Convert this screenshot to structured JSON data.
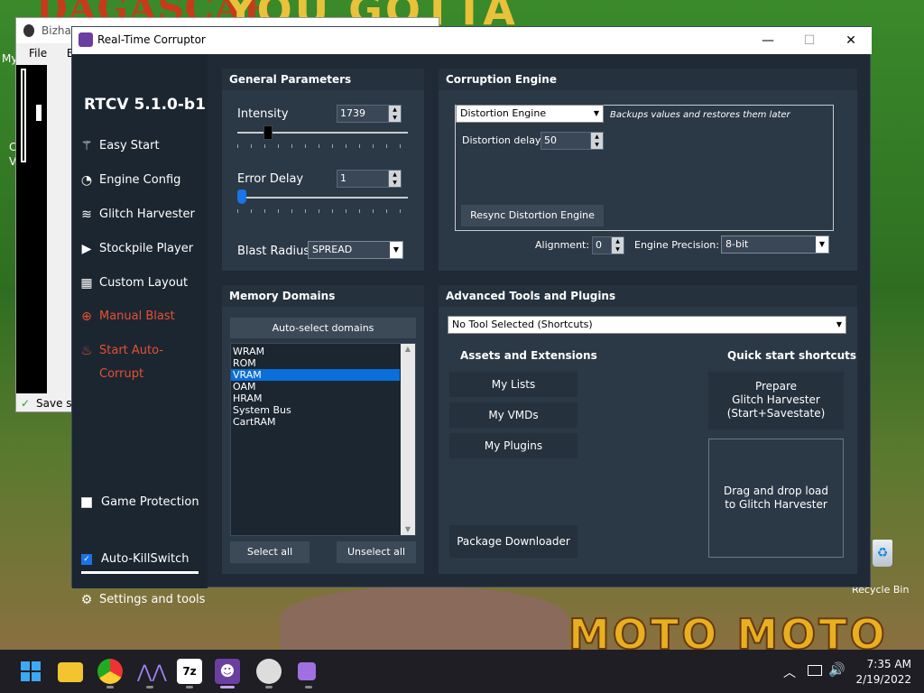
{
  "desktop": {
    "background_title": "DAGASCAR",
    "background_title2": "YOU GOTTA",
    "background_bottom": "MOTO MOTO",
    "left_labels": [
      "My",
      "C",
      "V"
    ],
    "recycle_bin_label": "Recycle Bin"
  },
  "bizhawk": {
    "title": "Bizhaw",
    "menu": [
      "File",
      "Em"
    ],
    "status": "Save slo"
  },
  "rtc": {
    "title": "Real-Time Corruptor",
    "window_buttons": {
      "minimize": "—",
      "maximize": "☐",
      "close": "✕"
    },
    "sidebar": {
      "version": "RTCV 5.1.0-b1",
      "items": [
        {
          "label": "Easy Start",
          "icon": "wand-icon",
          "color": "#ffffff"
        },
        {
          "label": "Engine Config",
          "icon": "gauge-icon",
          "color": "#ffffff"
        },
        {
          "label": "Glitch Harvester",
          "icon": "layers-icon",
          "color": "#ffffff"
        },
        {
          "label": "Stockpile Player",
          "icon": "play-icon",
          "color": "#ffffff"
        },
        {
          "label": "Custom Layout",
          "icon": "grid-icon",
          "color": "#ffffff"
        },
        {
          "label": "Manual Blast",
          "icon": "crosshair-icon",
          "color": "#e85030"
        },
        {
          "label": "Start Auto-Corrupt",
          "icon": "fire-icon",
          "color": "#e85030"
        }
      ],
      "game_protection": {
        "label": "Game Protection",
        "checked": false
      },
      "auto_killswitch": {
        "label": "Auto-KillSwitch",
        "checked": true
      },
      "settings": {
        "label": "Settings and tools",
        "icon": "gear-icon"
      }
    },
    "general": {
      "header": "General Parameters",
      "intensity_label": "Intensity",
      "intensity_value": "1739",
      "intensity_fraction": 0.2,
      "error_delay_label": "Error Delay",
      "error_delay_value": "1",
      "error_delay_fraction": 0.0,
      "blast_radius_label": "Blast Radius:",
      "blast_radius_value": "SPREAD"
    },
    "engine": {
      "header": "Corruption Engine",
      "engine_select": "Distortion Engine",
      "engine_desc": "Backups values and restores them later",
      "delay_label": "Distortion delay:",
      "delay_value": "50",
      "resync_button": "Resync Distortion Engine",
      "alignment_label": "Alignment:",
      "alignment_value": "0",
      "precision_label": "Engine Precision:",
      "precision_value": "8-bit"
    },
    "memory": {
      "header": "Memory Domains",
      "autoselect_button": "Auto-select domains",
      "domains": [
        {
          "label": "WRAM",
          "selected": false
        },
        {
          "label": "ROM",
          "selected": false
        },
        {
          "label": "VRAM",
          "selected": true
        },
        {
          "label": "OAM",
          "selected": false
        },
        {
          "label": "HRAM",
          "selected": false
        },
        {
          "label": "System Bus",
          "selected": false
        },
        {
          "label": "CartRAM",
          "selected": false
        }
      ],
      "select_all": "Select all",
      "unselect_all": "Unselect all"
    },
    "advanced": {
      "header": "Advanced Tools and Plugins",
      "tool_select": "No Tool Selected (Shortcuts)",
      "assets_header": "Assets and Extensions",
      "my_lists": "My Lists",
      "my_vmds": "My VMDs",
      "my_plugins": "My Plugins",
      "package_downloader": "Package Downloader",
      "quick_header": "Quick start shortcuts",
      "prepare_button": [
        "Prepare",
        "Glitch Harvester",
        "(Start+Savestate)"
      ],
      "drop_zone": [
        "Drag and drop load",
        "to Glitch Harvester"
      ]
    }
  },
  "taskbar": {
    "time": "7:35 AM",
    "date": "2/19/2022",
    "apps": [
      "windows-start-icon",
      "file-explorer-icon",
      "chrome-icon",
      "app-icon",
      "7zip-icon",
      "rtc-icon",
      "bizhawk-icon",
      "cube-icon"
    ],
    "tray": [
      "chevron-up-icon",
      "monitor-icon",
      "volume-icon"
    ]
  }
}
